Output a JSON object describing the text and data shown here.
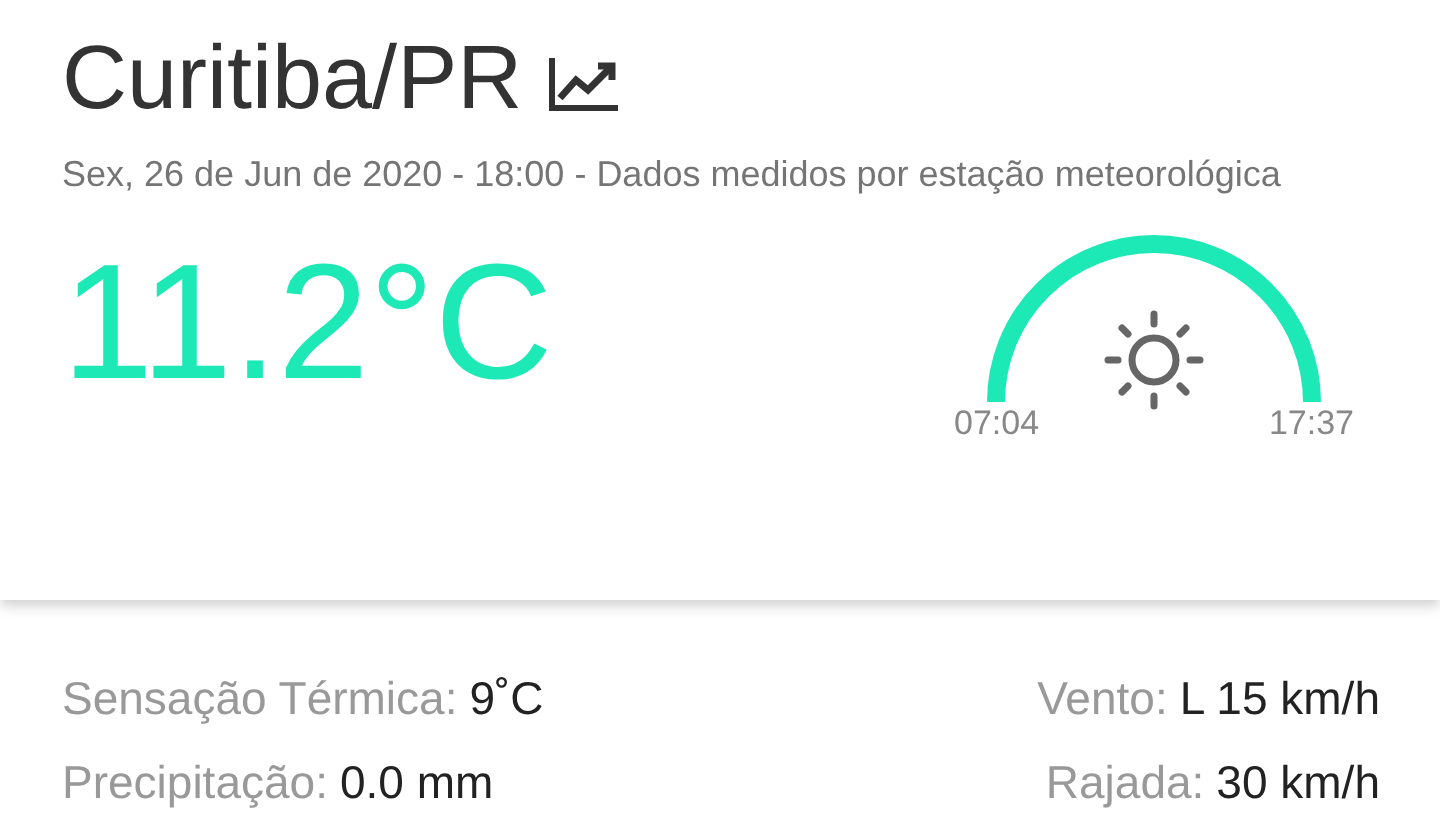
{
  "location": {
    "title": "Curitiba/PR"
  },
  "subtitle": "Sex, 26 de Jun de 2020 - 18:00 - Dados medidos por estação meteorológica",
  "temperature": "11.2°C",
  "sun": {
    "sunrise": "07:04",
    "sunset": "17:37"
  },
  "details": [
    {
      "label": "Sensação Térmica:",
      "value": "9˚C"
    },
    {
      "label": "Vento:",
      "value": "L 15 km/h"
    },
    {
      "label": "Precipitação:",
      "value": "0.0 mm"
    },
    {
      "label": "Rajada:",
      "value": "30 km/h"
    }
  ]
}
